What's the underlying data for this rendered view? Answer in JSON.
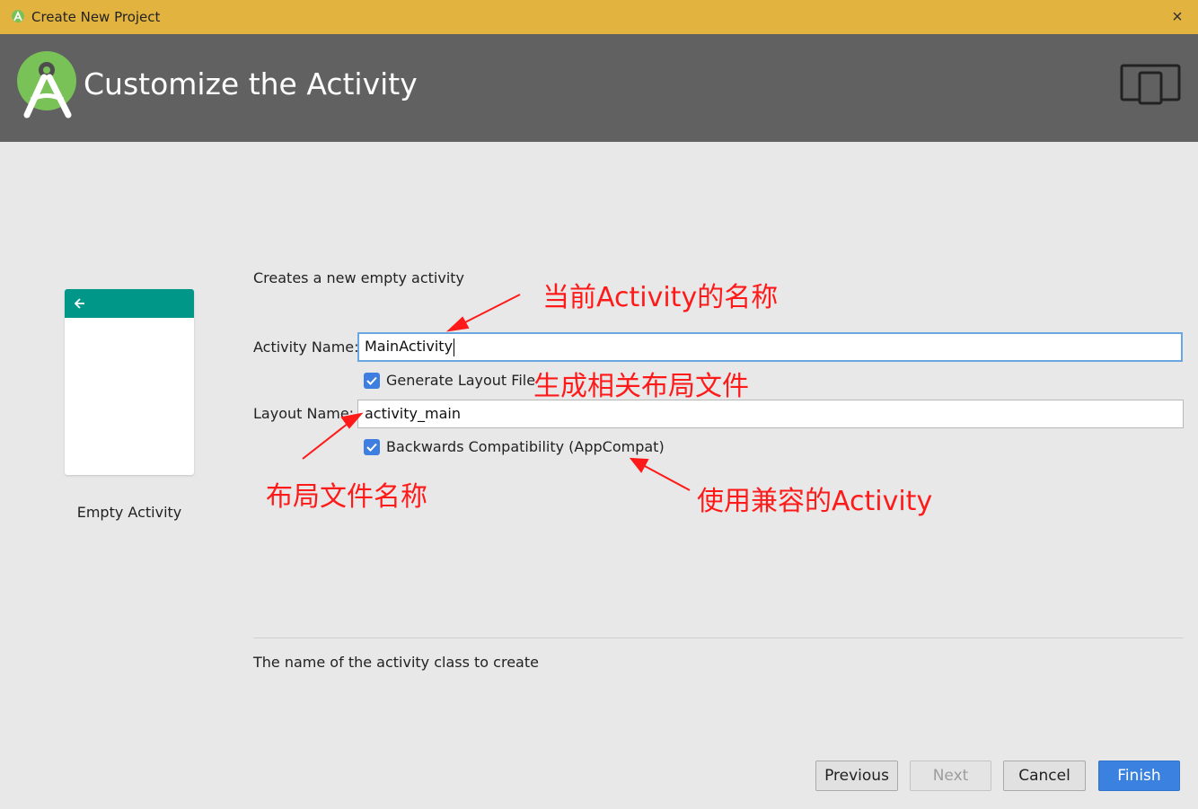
{
  "window": {
    "title": "Create New Project",
    "close_icon": "×"
  },
  "header": {
    "title": "Customize the Activity"
  },
  "template": {
    "label": "Empty Activity",
    "appbar_color": "#009688"
  },
  "form": {
    "description": "Creates a new empty activity",
    "activity_name_label": "Activity Name:",
    "activity_name_value": "MainActivity",
    "generate_layout_label": "Generate Layout File",
    "generate_layout_checked": true,
    "layout_name_label": "Layout Name:",
    "layout_name_value": "activity_main",
    "backwards_compat_label": "Backwards Compatibility (AppCompat)",
    "backwards_compat_checked": true,
    "hint": "The name of the activity class to create"
  },
  "buttons": {
    "previous": "Previous",
    "next": "Next",
    "cancel": "Cancel",
    "finish": "Finish"
  },
  "annotations": {
    "activity_name_note": "当前Activity的名称",
    "generate_layout_note": "生成相关布局文件",
    "layout_name_note": "布局文件名称",
    "appcompat_note": "使用兼容的Activity",
    "color": "#ff1a1a"
  },
  "colors": {
    "titlebar": "#e3b33f",
    "header": "#616161",
    "accent": "#3b82e0"
  }
}
